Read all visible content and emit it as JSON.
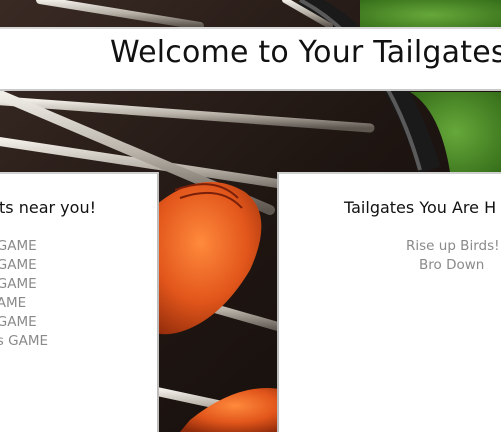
{
  "header": {
    "title": "Welcome to Your Tailgates"
  },
  "near_panel": {
    "heading": "ts near you!",
    "items": [
      "GAME",
      "GAME",
      " GAME",
      "AME",
      "GAME",
      "s GAME"
    ]
  },
  "hosting_panel": {
    "heading": "Tailgates You Are H",
    "items": [
      "Rise up Birds!",
      "Bro Down"
    ]
  },
  "colors": {
    "banner_bg": "#ffffff",
    "panel_bg": "#ffffff",
    "heading_text": "#111111",
    "item_text": "#8a8a8a",
    "grill_dark": "#2a1d18",
    "grass": "#3f7a1e",
    "hotdog": "#d2541c"
  },
  "background": {
    "icon": "grill-hotdogs-image"
  }
}
